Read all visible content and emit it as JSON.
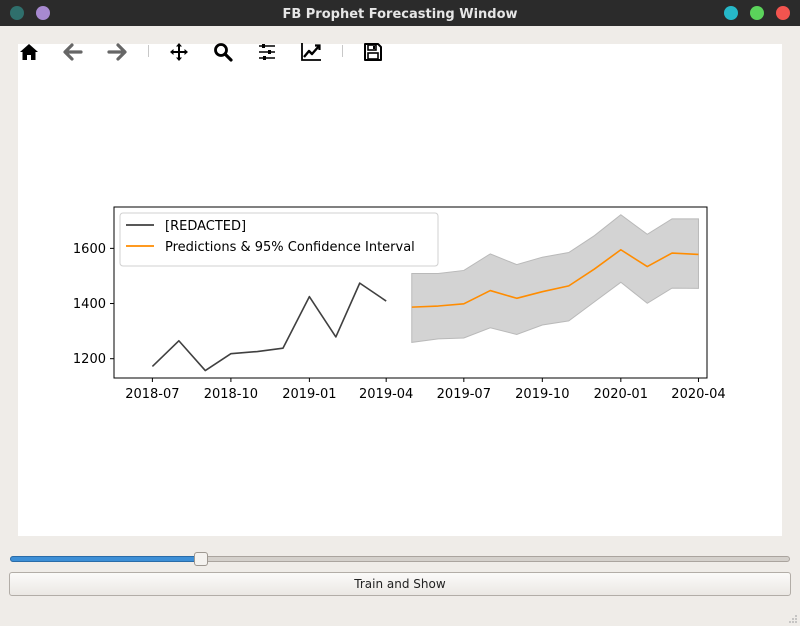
{
  "window": {
    "title": "FB Prophet Forecasting Window",
    "left_dot_colors": [
      "#2f6f6c",
      "#a789d0"
    ],
    "right_dot_colors": [
      "#26b8c8",
      "#5bd35b",
      "#f2544f"
    ]
  },
  "toolbar": {
    "icons": [
      "home-icon",
      "back-arrow-icon",
      "forward-arrow-icon",
      "pan-icon",
      "zoom-icon",
      "configure-subplots-icon",
      "edit-axis-icon",
      "save-icon"
    ]
  },
  "slider": {
    "value_fraction": 0.243
  },
  "train_button": {
    "label": "Train and Show"
  },
  "chart_data": {
    "type": "line",
    "title": "",
    "xlabel": "",
    "ylabel": "",
    "ylim": [
      1130,
      1750
    ],
    "yticks": [
      1200,
      1400,
      1600
    ],
    "ytick_labels": [
      "1200",
      "1400",
      "1600"
    ],
    "xticks": [
      "2018-07-01",
      "2018-10-01",
      "2019-01-01",
      "2019-04-01",
      "2019-07-01",
      "2019-10-01",
      "2020-01-01",
      "2020-04-01"
    ],
    "xtick_labels": [
      "2018-07",
      "2018-10",
      "2019-01",
      "2019-04",
      "2019-07",
      "2019-10",
      "2020-01",
      "2020-04"
    ],
    "xlim": [
      "2018-05-17",
      "2020-04-11"
    ],
    "grid": false,
    "legend": {
      "placement": "top-left"
    },
    "series": [
      {
        "name": "[REDACTED]",
        "color": "#404040",
        "x": [
          "2018-07-01",
          "2018-08-01",
          "2018-09-01",
          "2018-10-01",
          "2018-11-01",
          "2018-12-01",
          "2019-01-01",
          "2019-02-01",
          "2019-03-01",
          "2019-04-01"
        ],
        "y": [
          1172,
          1265,
          1157,
          1218,
          1226,
          1238,
          1425,
          1279,
          1474,
          1409
        ]
      },
      {
        "name": "Predictions & 95% Confidence Interval",
        "color": "#ff8c00",
        "band_color": "#d3d3d3",
        "x": [
          "2019-05-01",
          "2019-06-01",
          "2019-07-01",
          "2019-08-01",
          "2019-09-01",
          "2019-10-01",
          "2019-11-01",
          "2019-12-01",
          "2020-01-01",
          "2020-02-01",
          "2020-03-01",
          "2020-04-01"
        ],
        "y": [
          1387,
          1391,
          1399,
          1447,
          1419,
          1443,
          1464,
          1525,
          1595,
          1534,
          1583,
          1578
        ],
        "lower": [
          1259,
          1272,
          1275,
          1312,
          1288,
          1322,
          1337,
          1406,
          1477,
          1401,
          1456,
          1455
        ],
        "upper": [
          1509,
          1509,
          1520,
          1580,
          1541,
          1568,
          1585,
          1646,
          1722,
          1651,
          1707,
          1707
        ]
      }
    ]
  }
}
